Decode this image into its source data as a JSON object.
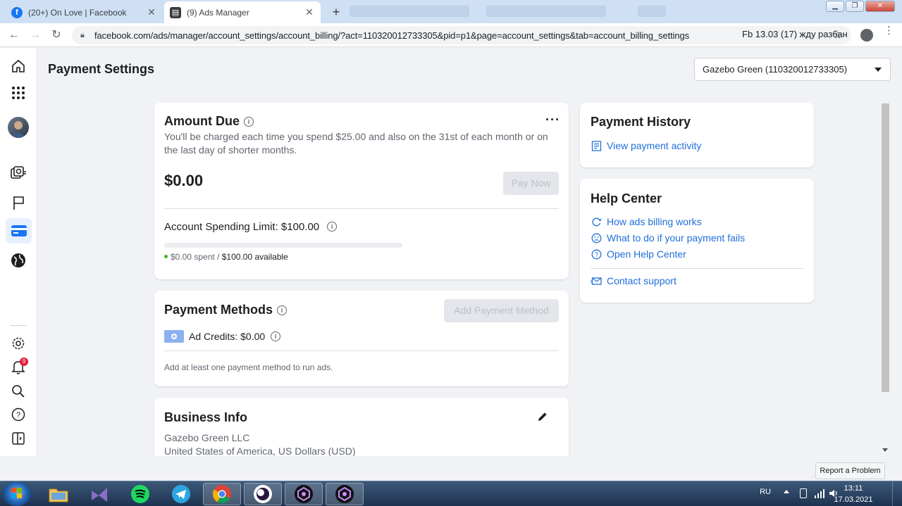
{
  "browser": {
    "tabs": [
      {
        "title": "(20+) On Love | Facebook",
        "favicon": "facebook-icon",
        "active": false
      },
      {
        "title": "(9) Ads Manager",
        "favicon": "ads-manager-icon",
        "active": true
      }
    ],
    "url": "facebook.com/ads/manager/account_settings/account_billing/?act=110320012733305&pid=p1&page=account_settings&tab=account_billing_settings",
    "bookmark_label": "Fb 13.03 (17) жду разбан"
  },
  "header": {
    "title": "Payment Settings",
    "account_selector": "Gazebo Green (110320012733305)"
  },
  "rail": {
    "notification_count": "9",
    "icons": [
      "home-icon",
      "apps-grid-icon",
      "avatar",
      "campaigns-icon",
      "pages-flag-icon",
      "billing-card-icon",
      "globe-icon",
      "settings-gear-icon",
      "notifications-bell-icon",
      "search-icon",
      "help-icon",
      "toggle-panel-icon"
    ],
    "active_icon": "billing-card-icon"
  },
  "amount_due": {
    "title": "Amount Due",
    "description": "You'll be charged each time you spend $25.00 and also on the 31st of each month or on the last day of shorter months.",
    "amount": "$0.00",
    "pay_now_label": "Pay Now",
    "spending_limit_label": "Account Spending Limit: $100.00",
    "spent_text": "$0.00 spent",
    "available_text": "$100.00 available",
    "separator": "/",
    "progress_fraction": 0.0
  },
  "payment_methods": {
    "title": "Payment Methods",
    "add_button_label": "Add Payment Method",
    "ad_credits_label": "Ad Credits: $0.00",
    "note": "Add at least one payment method to run ads."
  },
  "business_info": {
    "title": "Business Info",
    "company": "Gazebo Green LLC",
    "location_currency": "United States of America, US Dollars (USD)"
  },
  "payment_history": {
    "title": "Payment History",
    "view_activity_label": "View payment activity"
  },
  "help_center": {
    "title": "Help Center",
    "links": [
      "How ads billing works",
      "What to do if your payment fails",
      "Open Help Center"
    ],
    "contact_label": "Contact support"
  },
  "report_problem_label": "Report a Problem",
  "taskbar": {
    "language": "RU",
    "time": "13:11",
    "date": "17.03.2021"
  },
  "colors": {
    "link": "#216fdb",
    "accent_blue": "#1877f2",
    "page_bg": "#f0f2f5",
    "spent_dot": "#42b72a",
    "disabled_btn": "#e4e6eb"
  }
}
